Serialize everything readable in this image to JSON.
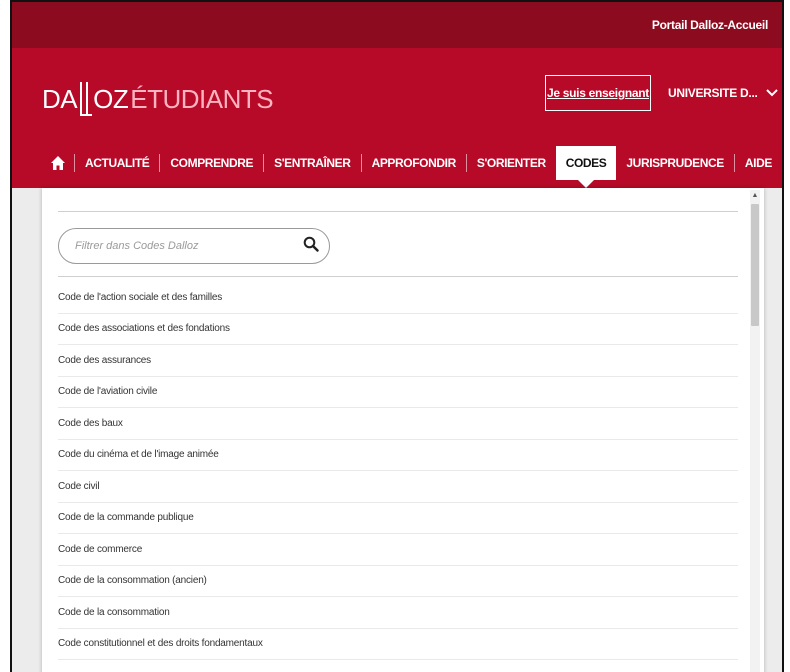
{
  "topbar": {
    "portal_link": "Portail Dalloz-Accueil"
  },
  "logo": {
    "part1": "DA",
    "part2": "OZ",
    "part3": "ÉTUDIANTS"
  },
  "header": {
    "teacher_button": "Je suis enseignant",
    "university": "UNIVERSITE D..."
  },
  "nav": {
    "items": [
      {
        "label": "ACTUALITÉ",
        "active": false
      },
      {
        "label": "COMPRENDRE",
        "active": false
      },
      {
        "label": "S'ENTRAÎNER",
        "active": false
      },
      {
        "label": "APPROFONDIR",
        "active": false
      },
      {
        "label": "S'ORIENTER",
        "active": false
      },
      {
        "label": "CODES",
        "active": true
      },
      {
        "label": "JURISPRUDENCE",
        "active": false
      },
      {
        "label": "AIDE",
        "active": false
      }
    ]
  },
  "codes_panel": {
    "filter_placeholder": "Filtrer dans Codes Dalloz",
    "items": [
      "Code de l'action sociale et des familles",
      "Code des associations et des fondations",
      "Code des assurances",
      "Code de l'aviation civile",
      "Code des baux",
      "Code du cinéma et de l'image animée",
      "Code civil",
      "Code de la commande publique",
      "Code de commerce",
      "Code de la consommation (ancien)",
      "Code de la consommation",
      "Code constitutionnel et des droits fondamentaux"
    ]
  },
  "icons": [
    "home-icon",
    "search-icon",
    "chevron-down-icon",
    "scroll-up-arrow-icon"
  ],
  "colors": {
    "topbar": "#8c0b1f",
    "header": "#b70a28",
    "accent_light": "#ffb2bf"
  }
}
